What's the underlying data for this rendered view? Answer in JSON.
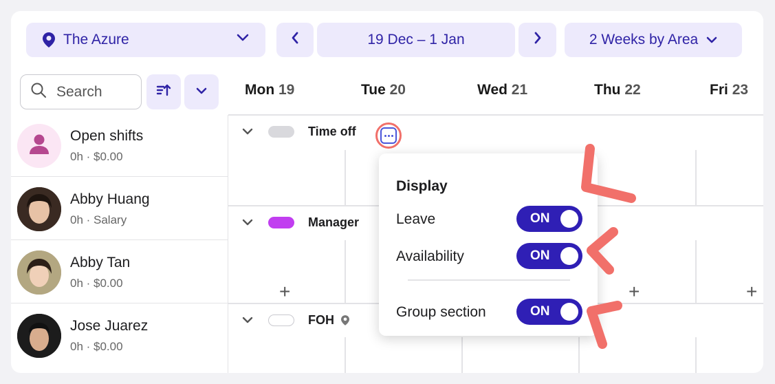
{
  "location": {
    "name": "The Azure",
    "icon": "map-pin-icon"
  },
  "date_nav": {
    "range": "19 Dec – 1 Jan",
    "prev_icon": "chevron-left-icon",
    "next_icon": "chevron-right-icon"
  },
  "view_selector": {
    "label": "2 Weeks by Area"
  },
  "search": {
    "placeholder": "Search"
  },
  "days": [
    {
      "dow": "Mon",
      "num": "19"
    },
    {
      "dow": "Tue",
      "num": "20"
    },
    {
      "dow": "Wed",
      "num": "21"
    },
    {
      "dow": "Thu",
      "num": "22"
    },
    {
      "dow": "Fri",
      "num": "23"
    }
  ],
  "staff": [
    {
      "name": "Open shifts",
      "sub": "0h · $0.00"
    },
    {
      "name": "Abby Huang",
      "sub": "0h · Salary"
    },
    {
      "name": "Abby Tan",
      "sub": "0h · $0.00"
    },
    {
      "name": "Jose Juarez",
      "sub": "0h · $0.00"
    }
  ],
  "sections": [
    {
      "name": "Time off",
      "color": "#d9d9dd"
    },
    {
      "name": "Manager",
      "color": "#c13ef0"
    },
    {
      "name": "FOH",
      "color": "#ffffff"
    }
  ],
  "display_popup": {
    "title": "Display",
    "rows": [
      {
        "label": "Leave",
        "state": "ON"
      },
      {
        "label": "Availability",
        "state": "ON"
      },
      {
        "label": "Group section",
        "state": "ON"
      }
    ]
  },
  "colors": {
    "accent": "#2f1fb5",
    "pill_bg": "#edeafc",
    "annotation": "#f1706a"
  }
}
